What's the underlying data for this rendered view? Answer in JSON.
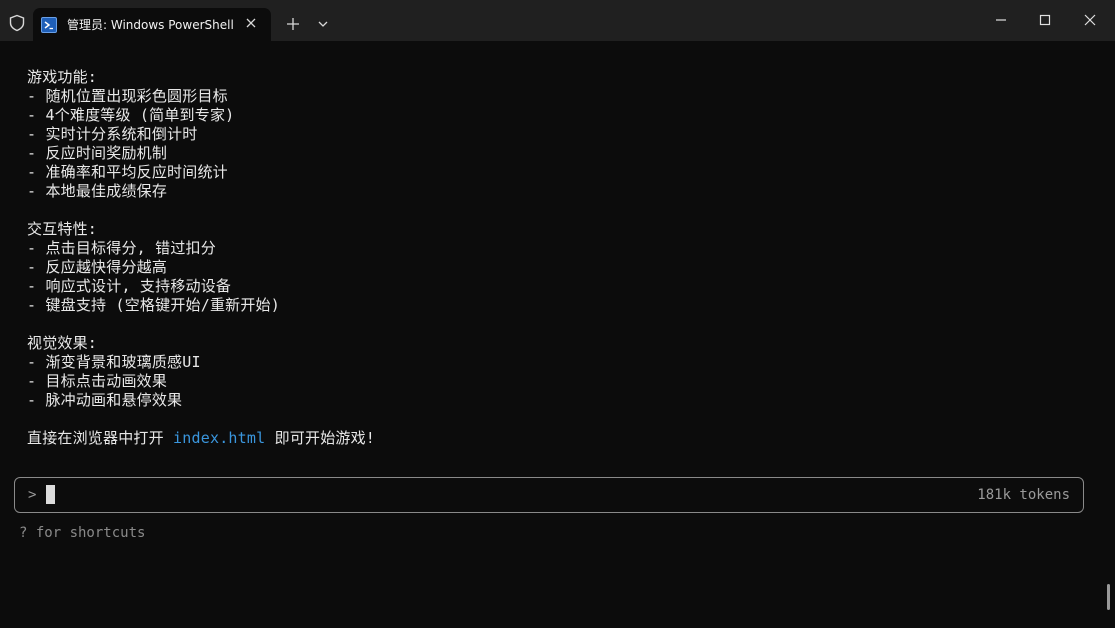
{
  "window": {
    "tab_title": "管理员: Windows PowerShell"
  },
  "terminal": {
    "lines": [
      "游戏功能:",
      "- 随机位置出现彩色圆形目标",
      "- 4个难度等级 (简单到专家)",
      "- 实时计分系统和倒计时",
      "- 反应时间奖励机制",
      "- 准确率和平均反应时间统计",
      "- 本地最佳成绩保存",
      "",
      "交互特性:",
      "- 点击目标得分, 错过扣分",
      "- 反应越快得分越高",
      "- 响应式设计, 支持移动设备",
      "- 键盘支持 (空格键开始/重新开始)",
      "",
      "视觉效果:",
      "- 渐变背景和玻璃质感UI",
      "- 目标点击动画效果",
      "- 脉冲动画和悬停效果",
      ""
    ],
    "final_line_prefix": "直接在浏览器中打开 ",
    "final_line_link": "index.html",
    "final_line_suffix": " 即可开始游戏!"
  },
  "input": {
    "prompt": ">",
    "tokens": "181k tokens"
  },
  "hint": "? for shortcuts",
  "colors": {
    "background": "#0c0c0c",
    "titlebar": "#202020",
    "text": "#e8e8e8",
    "link": "#3a96dd",
    "muted": "#8a8a8a"
  }
}
